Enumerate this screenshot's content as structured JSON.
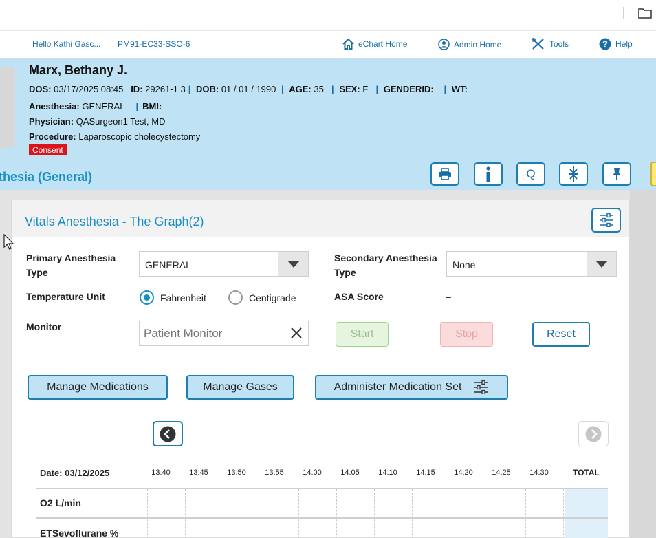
{
  "nav": {
    "greeting": "Hello Kathi Gasc...",
    "machine": "PM91-EC33-SSO-6",
    "echart_home": "eChart Home",
    "admin_home": "Admin Home",
    "tools": "Tools",
    "help": "Help"
  },
  "patient": {
    "name": "Marx, Bethany J.",
    "dos_label": "DOS:",
    "dos": "03/17/2025 08:45",
    "id_label": "ID:",
    "id": "29261-1 3",
    "dob_label": "DOB:",
    "dob": "01 / 01 / 1990",
    "age_label": "AGE:",
    "age": "35",
    "sex_label": "SEX:",
    "sex": "F",
    "genderid_label": "GENDERID:",
    "wt_label": "WT:",
    "anesthesia_label": "Anesthesia:",
    "anesthesia": "GENERAL",
    "bmi_label": "BMI:",
    "physician_label": "Physician:",
    "physician": "QASurgeon1 Test, MD",
    "procedure_label": "Procedure:",
    "procedure": "Laparoscopic cholecystectomy",
    "consent": "Consent"
  },
  "section_title": "thesia (General)",
  "toolbar": {
    "print_icon": "printer-icon",
    "info_icon": "info-icon",
    "q_label": "Q",
    "collapse_icon": "collapse-icon",
    "pin_icon": "pin-icon"
  },
  "panel": {
    "title": "Vitals Anesthesia - The Graph(2)",
    "primary_label": "Primary Anesthesia Type",
    "primary_value": "GENERAL",
    "secondary_label": "Secondary Anesthesia Type",
    "secondary_value": "None",
    "temp_label": "Temperature Unit",
    "temp_options": [
      "Fahrenheit",
      "Centigrade"
    ],
    "temp_selected": "Fahrenheit",
    "asa_label": "ASA Score",
    "asa_value": "–",
    "monitor_label": "Monitor",
    "monitor_placeholder": "Patient Monitor",
    "start": "Start",
    "stop": "Stop",
    "reset": "Reset",
    "manage_medications": "Manage Medications",
    "manage_gases": "Manage Gases",
    "administer_set": "Administer Medication Set"
  },
  "grid": {
    "date": "Date: 03/12/2025",
    "times": [
      "13:40",
      "13:45",
      "13:50",
      "13:55",
      "14:00",
      "14:05",
      "14:10",
      "14:15",
      "14:20",
      "14:25",
      "14:30"
    ],
    "total": "TOTAL",
    "rows": [
      "O2 L/min",
      "ETSevoflurane %"
    ]
  },
  "colors": {
    "accent": "#1a8fc4",
    "banner": "#bfe3f4",
    "consent": "#d9141b"
  }
}
